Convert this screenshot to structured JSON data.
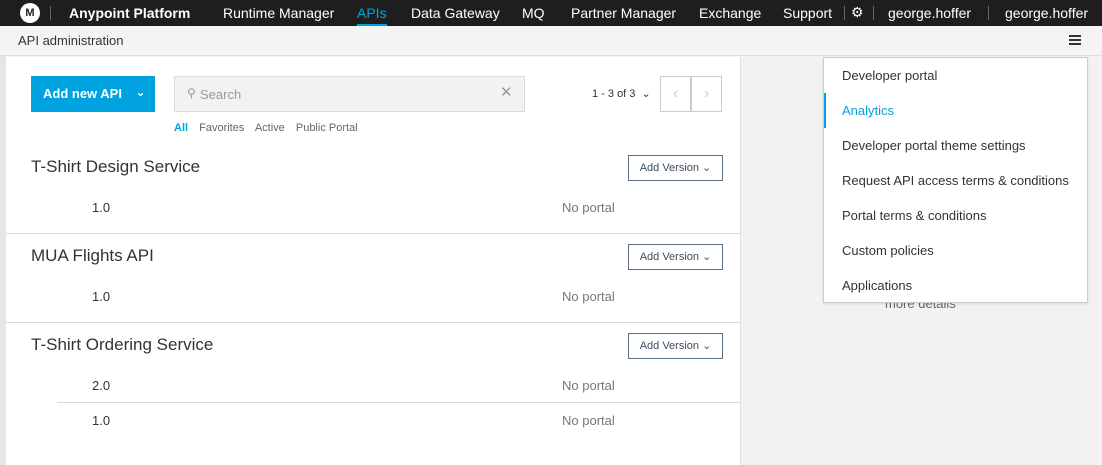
{
  "topnav": {
    "logo": "M",
    "brand": "Anypoint Platform",
    "items": [
      "Runtime Manager",
      "APIs",
      "Data Gateway",
      "MQ",
      "Partner Manager",
      "Exchange",
      "Support"
    ],
    "active": "APIs",
    "user1": "george.hoffer",
    "user2": "george.hoffer"
  },
  "subheader": {
    "title": "API administration"
  },
  "toolbar": {
    "add_api_label": "Add new API",
    "search_placeholder": "Search",
    "pager_text": "1 - 3 of 3",
    "prev_label": "‹",
    "next_label": "›"
  },
  "filters": [
    "All",
    "Favorites",
    "Active",
    "Public Portal"
  ],
  "apis": [
    {
      "name": "T-Shirt Design Service",
      "add_version": "Add Version",
      "versions": [
        {
          "version": "1.0",
          "portal": "No portal"
        }
      ]
    },
    {
      "name": "MUA Flights API",
      "add_version": "Add Version",
      "versions": [
        {
          "version": "1.0",
          "portal": "No portal"
        }
      ]
    },
    {
      "name": "T-Shirt Ordering Service",
      "add_version": "Add Version",
      "versions": [
        {
          "version": "2.0",
          "portal": "No portal"
        },
        {
          "version": "1.0",
          "portal": "No portal"
        }
      ]
    }
  ],
  "dropdown": {
    "items": [
      "Developer portal",
      "Analytics",
      "Developer portal theme settings",
      "Request API access terms & conditions",
      "Portal terms & conditions",
      "Custom policies",
      "Applications"
    ],
    "active": "Analytics"
  },
  "background_text": "more details",
  "colors": {
    "accent": "#00a2df",
    "nav_bg": "#1e1e1e"
  }
}
